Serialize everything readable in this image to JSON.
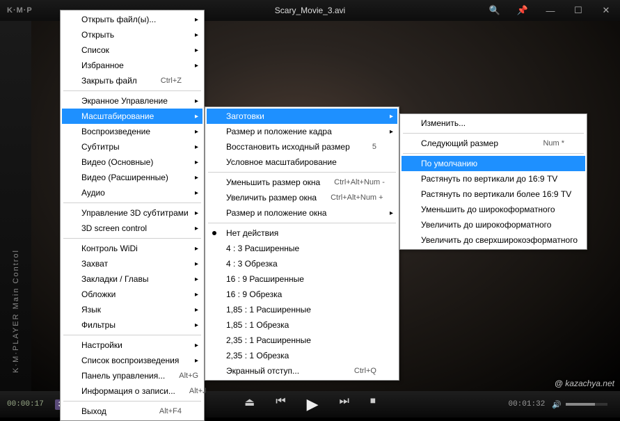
{
  "app": {
    "logo": "K·M·P",
    "title": "Scary_Movie_3.avi",
    "sidebar_label": "K·M·PLAYER  Main Control"
  },
  "titlebar": {
    "search": "search-icon",
    "pin": "pin-icon",
    "min": "minimize-icon",
    "max": "maximize-icon",
    "close": "close-icon"
  },
  "bottom": {
    "time_start": "00:00:17",
    "time_end": "00:01:32",
    "badge": "3D"
  },
  "watermark": "kazachya.net",
  "menu1": [
    {
      "label": "Открыть файл(ы)...",
      "sub": true
    },
    {
      "label": "Открыть",
      "sub": true
    },
    {
      "label": "Список",
      "sub": true
    },
    {
      "label": "Избранное",
      "sub": true
    },
    {
      "label": "Закрыть файл",
      "shortcut": "Ctrl+Z"
    },
    {
      "sep": true
    },
    {
      "label": "Экранное Управление",
      "sub": true
    },
    {
      "label": "Масштабирование",
      "sub": true,
      "hl": true
    },
    {
      "label": "Воспроизведение",
      "sub": true
    },
    {
      "label": "Субтитры",
      "sub": true
    },
    {
      "label": "Видео (Основные)",
      "sub": true
    },
    {
      "label": "Видео (Расширенные)",
      "sub": true
    },
    {
      "label": "Аудио",
      "sub": true
    },
    {
      "sep": true
    },
    {
      "label": "Управление 3D субтитрами",
      "sub": true
    },
    {
      "label": "3D screen control",
      "sub": true
    },
    {
      "sep": true
    },
    {
      "label": "Контроль WiDi",
      "sub": true
    },
    {
      "label": "Захват",
      "sub": true
    },
    {
      "label": "Закладки / Главы",
      "sub": true
    },
    {
      "label": "Обложки",
      "sub": true
    },
    {
      "label": "Язык",
      "sub": true
    },
    {
      "label": "Фильтры",
      "sub": true
    },
    {
      "sep": true
    },
    {
      "label": "Настройки",
      "sub": true
    },
    {
      "label": "Список воспроизведения",
      "sub": true
    },
    {
      "label": "Панель управления...",
      "shortcut": "Alt+G"
    },
    {
      "label": "Информация о записи...",
      "shortcut": "Alt+J"
    },
    {
      "sep": true
    },
    {
      "label": "Выход",
      "shortcut": "Alt+F4"
    }
  ],
  "menu2": [
    {
      "label": "Заготовки",
      "sub": true,
      "hl": true
    },
    {
      "label": "Размер и положение кадра",
      "sub": true
    },
    {
      "label": "Восстановить исходный размер",
      "shortcut": "5"
    },
    {
      "label": "Условное масштабирование"
    },
    {
      "sep": true
    },
    {
      "label": "Уменьшить размер окна",
      "shortcut": "Ctrl+Alt+Num -"
    },
    {
      "label": "Увеличить размер окна",
      "shortcut": "Ctrl+Alt+Num +"
    },
    {
      "label": "Размер и положение окна",
      "sub": true
    },
    {
      "sep": true
    },
    {
      "label": "Нет действия",
      "radio": true
    },
    {
      "label": "4 : 3  Расширенные"
    },
    {
      "label": "4 : 3  Обрезка"
    },
    {
      "label": "16 : 9  Расширенные"
    },
    {
      "label": "16 : 9  Обрезка"
    },
    {
      "label": "1,85 : 1  Расширенные"
    },
    {
      "label": "1,85 : 1  Обрезка"
    },
    {
      "label": "2,35 : 1  Расширенные"
    },
    {
      "label": "2,35 : 1  Обрезка"
    },
    {
      "label": "Экранный отступ...",
      "shortcut": "Ctrl+Q"
    }
  ],
  "menu3": [
    {
      "label": "Изменить..."
    },
    {
      "sep": true
    },
    {
      "label": "Следующий размер",
      "shortcut": "Num *"
    },
    {
      "sep": true
    },
    {
      "label": "По умолчанию",
      "hl": true
    },
    {
      "label": "Растянуть по вертикали до 16:9 TV"
    },
    {
      "label": "Растянуть по вертикали более 16:9 TV"
    },
    {
      "label": "Уменьшить до широкоформатного"
    },
    {
      "label": "Увеличить до широкоформатного"
    },
    {
      "label": "Увеличить до сверхширокоэформатного"
    }
  ]
}
